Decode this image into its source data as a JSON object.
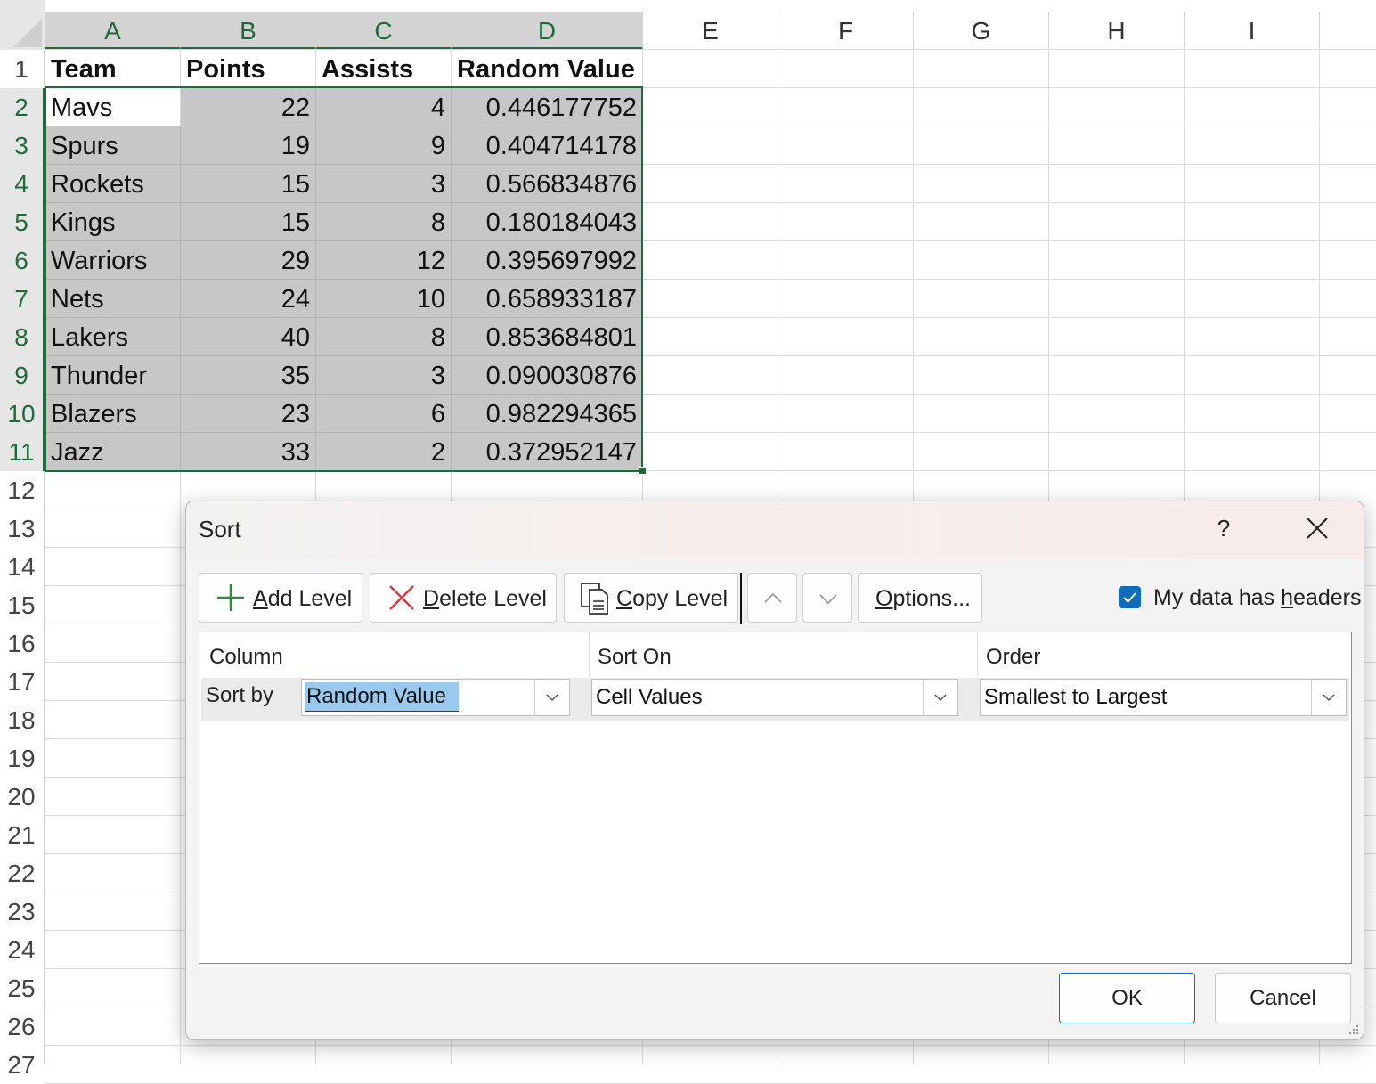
{
  "sheet": {
    "columns": [
      "A",
      "B",
      "C",
      "D",
      "E",
      "F",
      "G",
      "H",
      "I"
    ],
    "rows": [
      "1",
      "2",
      "3",
      "4",
      "5",
      "6",
      "7",
      "8",
      "9",
      "10",
      "11",
      "12",
      "13",
      "14",
      "15",
      "16",
      "17",
      "18",
      "19",
      "20",
      "21",
      "22",
      "23",
      "24",
      "25",
      "26",
      "27"
    ],
    "headers": [
      "Team",
      "Points",
      "Assists",
      "Random Value"
    ],
    "data": [
      [
        "Mavs",
        "22",
        "4",
        "0.446177752"
      ],
      [
        "Spurs",
        "19",
        "9",
        "0.404714178"
      ],
      [
        "Rockets",
        "15",
        "3",
        "0.566834876"
      ],
      [
        "Kings",
        "15",
        "8",
        "0.180184043"
      ],
      [
        "Warriors",
        "29",
        "12",
        "0.395697992"
      ],
      [
        "Nets",
        "24",
        "10",
        "0.658933187"
      ],
      [
        "Lakers",
        "40",
        "8",
        "0.853684801"
      ],
      [
        "Thunder",
        "35",
        "3",
        "0.090030876"
      ],
      [
        "Blazers",
        "23",
        "6",
        "0.982294365"
      ],
      [
        "Jazz",
        "33",
        "2",
        "0.372952147"
      ]
    ],
    "selection_color": "#1e6b3a"
  },
  "dialog": {
    "title": "Sort",
    "help": "?",
    "toolbar": {
      "add_level": {
        "pre": "",
        "key": "A",
        "post": "dd Level",
        "icon": "plus-icon"
      },
      "delete_level": {
        "pre": "",
        "key": "D",
        "post": "elete Level",
        "icon": "x-icon"
      },
      "copy_level": {
        "pre": "",
        "key": "C",
        "post": "opy Level",
        "icon": "copy-icon"
      },
      "options": {
        "pre": "",
        "key": "O",
        "post": "ptions...",
        "icon": ""
      }
    },
    "headers_checkbox": {
      "checked": true,
      "pre": "My data has ",
      "key": "h",
      "post": "eaders"
    },
    "columns": {
      "column": "Column",
      "sort_on": "Sort On",
      "order": "Order"
    },
    "level": {
      "label": "Sort by",
      "column_value": "Random Value",
      "sort_on_value": "Cell Values",
      "order_value": "Smallest to Largest"
    },
    "ok": "OK",
    "cancel": "Cancel",
    "accent": "#0f6cbd"
  }
}
